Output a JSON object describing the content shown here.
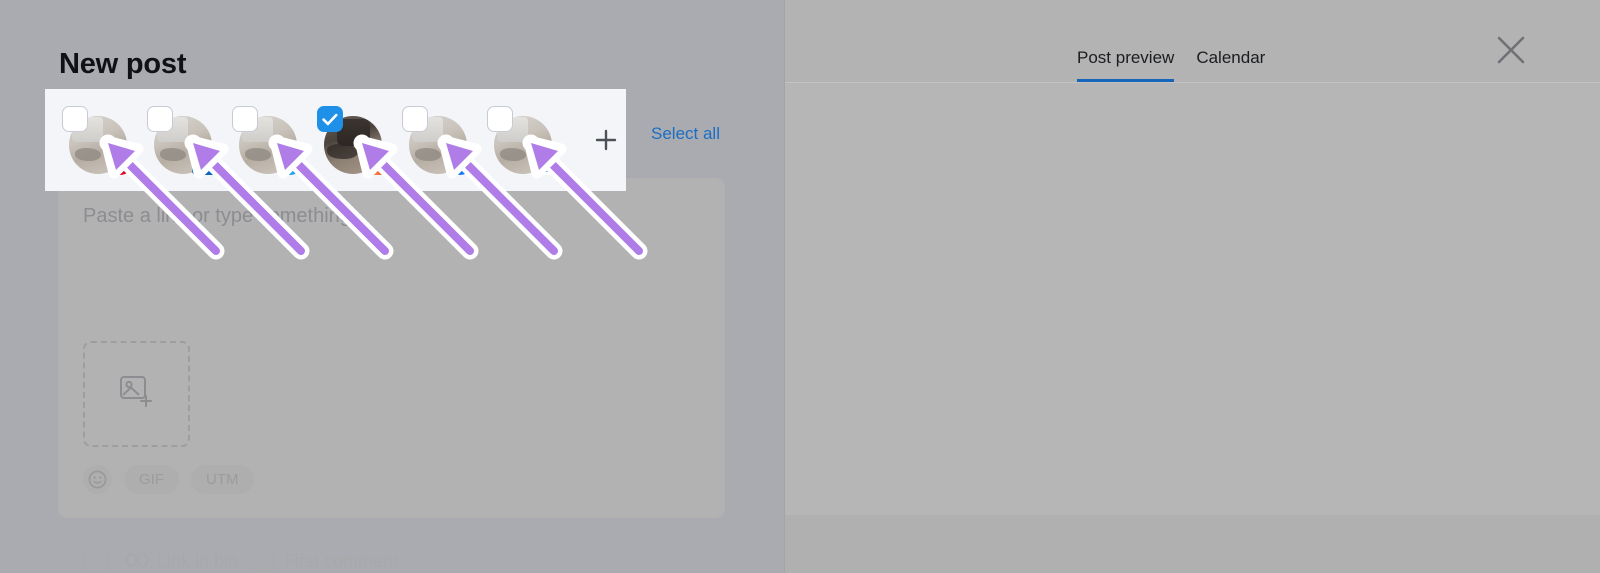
{
  "window": {
    "title": "New post",
    "close_icon": "close-icon"
  },
  "preview_panel": {
    "tabs": [
      {
        "label": "Post preview",
        "active": true
      },
      {
        "label": "Calendar",
        "active": false
      }
    ],
    "active_accent": "#1665b8"
  },
  "accounts_panel": {
    "select_all_label": "Select all",
    "add_account_icon": "plus-icon",
    "accounts": [
      {
        "platform": "pinterest",
        "icon": "pinterest-icon",
        "checked": false,
        "color": "#e60023"
      },
      {
        "platform": "linkedin",
        "icon": "linkedin-icon",
        "checked": false,
        "color": "#0a66c2"
      },
      {
        "platform": "twitter",
        "icon": "twitter-icon",
        "checked": false,
        "color": "#1da1f2"
      },
      {
        "platform": "instagram",
        "icon": "instagram-icon",
        "checked": true,
        "color": "#e1306c"
      },
      {
        "platform": "facebook",
        "icon": "facebook-icon",
        "checked": false,
        "color": "#1877f2"
      },
      {
        "platform": "google-business-profile",
        "icon": "google-business-icon",
        "checked": false,
        "color": "#4285f4"
      }
    ],
    "checked_color": "#1e90e8",
    "panel_background": "#f4f5f9"
  },
  "composer": {
    "placeholder": "Paste a link or type something",
    "upload_icon": "add-image-icon",
    "tools": [
      {
        "label": "",
        "icon": "emoji-icon"
      },
      {
        "label": "GIF",
        "icon": "gif-icon"
      },
      {
        "label": "UTM",
        "icon": "utm-icon"
      }
    ]
  },
  "bottom_options": [
    {
      "label": "Link in bio",
      "icon": "link-icon",
      "checked": false
    },
    {
      "label": "First comment",
      "icon": "checkbox-icon",
      "checked": false
    }
  ],
  "annotation": {
    "arrow_color": "#b07de8",
    "arrow_outline": "#ffffff",
    "arrow_count": 6
  }
}
